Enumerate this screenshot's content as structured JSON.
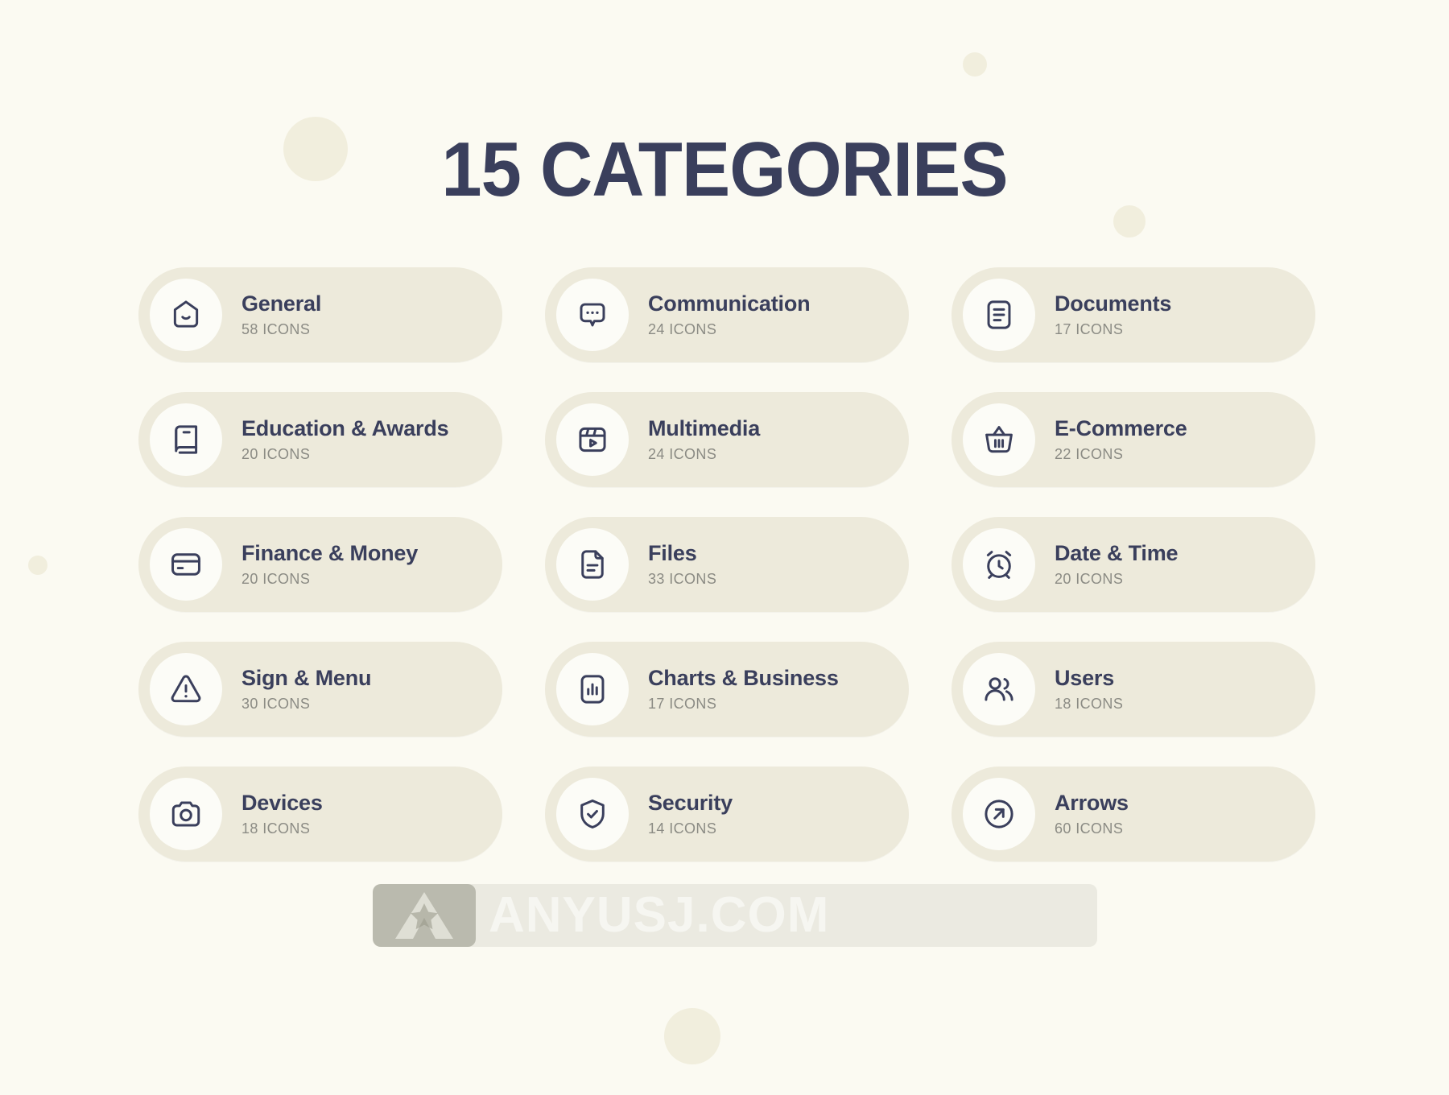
{
  "page": {
    "title": "15 CATEGORIES",
    "background_color": "#fbfaf2",
    "card_color": "#edeadb",
    "badge_color": "#fcfcf7",
    "title_color": "#3a3f5c",
    "count_color": "#8b8b84"
  },
  "categories": [
    {
      "name": "General",
      "count": "58 ICONS",
      "icon": "home-icon"
    },
    {
      "name": "Communication",
      "count": "24 ICONS",
      "icon": "chat-bubble-icon"
    },
    {
      "name": "Documents",
      "count": "17 ICONS",
      "icon": "document-icon"
    },
    {
      "name": "Education & Awards",
      "count": "20 ICONS",
      "icon": "book-icon"
    },
    {
      "name": "Multimedia",
      "count": "24 ICONS",
      "icon": "video-player-icon"
    },
    {
      "name": "E-Commerce",
      "count": "22 ICONS",
      "icon": "shopping-basket-icon"
    },
    {
      "name": "Finance & Money",
      "count": "20 ICONS",
      "icon": "credit-card-icon"
    },
    {
      "name": "Files",
      "count": "33 ICONS",
      "icon": "file-icon"
    },
    {
      "name": "Date & Time",
      "count": "20 ICONS",
      "icon": "alarm-clock-icon"
    },
    {
      "name": "Sign & Menu",
      "count": "30 ICONS",
      "icon": "warning-triangle-icon"
    },
    {
      "name": "Charts & Business",
      "count": "17 ICONS",
      "icon": "bar-chart-icon"
    },
    {
      "name": "Users",
      "count": "18 ICONS",
      "icon": "users-icon"
    },
    {
      "name": "Devices",
      "count": "18 ICONS",
      "icon": "camera-icon"
    },
    {
      "name": "Security",
      "count": "14 ICONS",
      "icon": "shield-check-icon"
    },
    {
      "name": "Arrows",
      "count": "60 ICONS",
      "icon": "arrow-up-right-circle-icon"
    }
  ],
  "watermark": {
    "text": "ANYUSJ.COM",
    "logo": "star-a-logo-icon"
  }
}
